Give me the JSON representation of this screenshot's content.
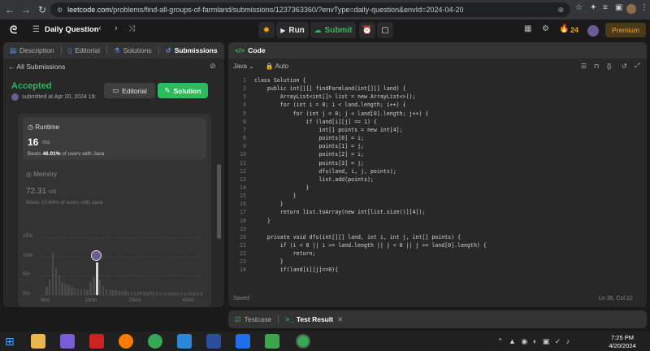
{
  "browser": {
    "url_host": "leetcode.com",
    "url_path": "/problems/find-all-groups-of-farmland/submissions/1237363360/?envType=daily-question&envId=2024-04-20"
  },
  "topbar": {
    "daily_label": "Daily Question",
    "run_label": "Run",
    "submit_label": "Submit",
    "streak": "24",
    "premium_label": "Premium"
  },
  "left_tabs": [
    "Description",
    "Editorial",
    "Solutions",
    "Submissions"
  ],
  "submission": {
    "back_label": "All Submissions",
    "status": "Accepted",
    "submitted": "submitted at Apr 20, 2024 19:",
    "editorial_btn": "Editorial",
    "solution_btn": "Solution",
    "runtime_label": "Runtime",
    "runtime_value": "16",
    "runtime_unit": "ms",
    "runtime_beats_prefix": "Beats",
    "runtime_beats": "46.01%",
    "runtime_beats_suffix": "of users with Java",
    "memory_label": "Memory",
    "memory_value": "72.31",
    "memory_unit": "MB",
    "memory_beats": "Beats 13.69% of users with Java"
  },
  "chart_data": {
    "type": "bar",
    "y_ticks": [
      "15%",
      "10%",
      "5%",
      "0%"
    ],
    "x_ticks": [
      "3ms",
      "13ms",
      "23ms",
      "41ms"
    ],
    "ylim": [
      0,
      15
    ],
    "values": [
      2.2,
      4.1,
      11.0,
      7.0,
      5.2,
      3.4,
      3.0,
      2.5,
      2.2,
      1.8,
      1.6,
      1.4,
      1.4,
      1.2,
      3.4,
      4.6,
      8.4,
      4.0,
      2.3,
      1.5,
      1.3,
      1.2,
      1.2,
      1.1,
      1.1,
      1.0,
      0.9,
      0.9,
      0.9,
      0.8,
      0.8,
      0.8,
      0.8,
      0.8,
      0.8,
      0.8,
      0.7,
      0.7,
      0.7,
      0.7,
      0.7,
      0.7,
      0.7,
      0.7,
      0.6,
      0.6,
      0.6,
      0.6,
      0.6,
      0.6
    ],
    "highlight_index": 16
  },
  "editor": {
    "title": "Code",
    "language": "Java",
    "mode": "Auto",
    "status_left": "Saved",
    "status_right": "Ln 36, Col 12",
    "lines": [
      "class Solution {",
      "    public int[][] findFarmland(int[][] land) {",
      "        ArrayList<int[]> list = new ArrayList<>();",
      "        for (int i = 0; i < land.length; i++) {",
      "            for (int j = 0; j < land[0].length; j++) {",
      "                if (land[i][j] == 1) {",
      "                    int[] points = new int[4];",
      "                    points[0] = i;",
      "                    points[1] = j;",
      "                    points[2] = i;",
      "                    points[3] = j;",
      "                    dfs(land, i, j, points);",
      "                    list.add(points);",
      "                }",
      "            }",
      "        }",
      "        return list.toArray(new int[list.size()][4]);",
      "    }",
      "",
      "    private void dfs(int[][] land, int i, int j, int[] points) {",
      "        if (i < 0 || i >= land.length || j < 0 || j >= land[0].length) {",
      "            return;",
      "        }",
      "        if(land[i][j]==0){"
    ]
  },
  "bottom_tabs": [
    "Testcase",
    "Test Result"
  ],
  "taskbar": {
    "time": "7:25 PM",
    "date": "4/20/2024"
  },
  "colors": {
    "accent_green": "#2cbb5d",
    "accepted": "#2db55d",
    "orange": "#ffa116",
    "premium": "#f5a623"
  }
}
